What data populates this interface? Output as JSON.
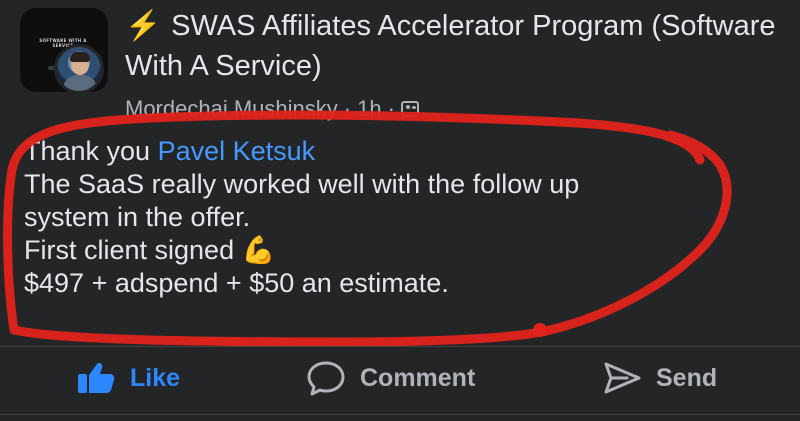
{
  "post": {
    "group_title_icon": "lightning-bolt",
    "group_title": "SWAS Affiliates Accelerator Program (Software With A Service)",
    "group_cover_text": "SOFTWARE WITH A SERVICE",
    "author": "Mordechai Mushinsky",
    "separator": "·",
    "time": "1h",
    "audience_icon": "members-icon",
    "body": {
      "greeting": "Thank you",
      "mention": "Pavel Ketsuk",
      "line2": "The SaaS really worked well with the follow up",
      "line3": "system in the offer.",
      "line4": "First client signed",
      "line4_emoji": "💪",
      "line5": "$497 + adspend + $50 an estimate."
    }
  },
  "actions": {
    "like_label": "Like",
    "comment_label": "Comment",
    "send_label": "Send"
  },
  "colors": {
    "background": "#242526",
    "text": "#e4e6eb",
    "secondary": "#b0b3b8",
    "link": "#4599ff",
    "like_blue": "#2d88ff",
    "annotation_red": "#e2231a"
  }
}
